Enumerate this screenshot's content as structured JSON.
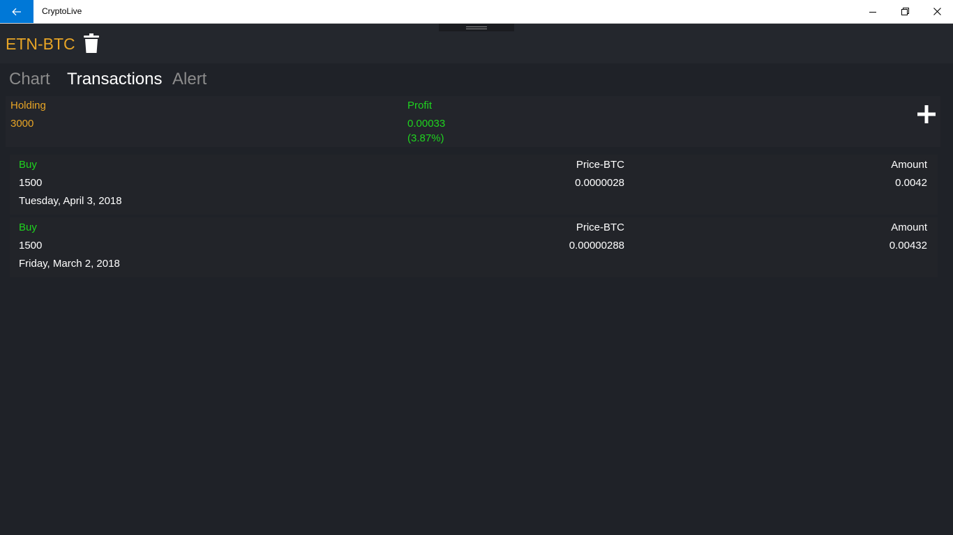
{
  "window": {
    "title": "CryptoLive"
  },
  "header": {
    "pair": "ETN-BTC"
  },
  "tabs": [
    {
      "label": "Chart",
      "active": false
    },
    {
      "label": "Transactions",
      "active": true
    },
    {
      "label": "Alert",
      "active": false
    }
  ],
  "summary": {
    "holding_label": "Holding",
    "holding_value": "3000",
    "profit_label": "Profit",
    "profit_value": "0.00033",
    "profit_percent": "(3.87%)"
  },
  "transactions": [
    {
      "type": "Buy",
      "quantity": "1500",
      "date": "Tuesday, April 3, 2018",
      "price_label": "Price-BTC",
      "price": "0.0000028",
      "amount_label": "Amount",
      "amount": "0.0042"
    },
    {
      "type": "Buy",
      "quantity": "1500",
      "date": "Friday, March 2, 2018",
      "price_label": "Price-BTC",
      "price": "0.00000288",
      "amount_label": "Amount",
      "amount": "0.00432"
    }
  ],
  "colors": {
    "accent_orange": "#e8a526",
    "profit_green": "#1fd41f",
    "titlebar_blue": "#0078d7",
    "background": "#1f2228"
  },
  "icons": {
    "back": "back-arrow-icon",
    "delete": "trash-icon",
    "add": "plus-icon",
    "minimize": "minimize-icon",
    "restore": "restore-icon",
    "close": "close-icon"
  }
}
